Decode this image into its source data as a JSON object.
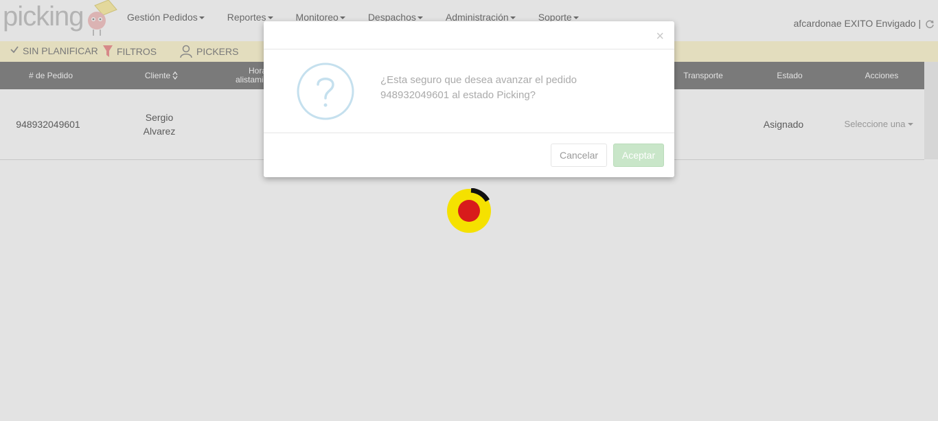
{
  "app": {
    "logo_text": "picking",
    "nav": [
      {
        "label": "Gestión Pedidos"
      },
      {
        "label": "Reportes"
      },
      {
        "label": "Monitoreo"
      },
      {
        "label": "Despachos"
      },
      {
        "label": "Administración"
      },
      {
        "label": "Soporte"
      }
    ],
    "user": "afcardonae EXITO Envigado |"
  },
  "toolbar": {
    "sin_planificar": "SIN PLANIFICAR",
    "filtros": "FILTROS",
    "pickers": "PICKERS"
  },
  "table": {
    "headers": {
      "pedido": "# de Pedido",
      "cliente": "Cliente",
      "hora": "Hora alistamiento",
      "transporte": "Transporte",
      "estado": "Estado",
      "acciones": "Acciones"
    },
    "rows": [
      {
        "pedido": "948932049601",
        "cliente": "Sergio Alvarez",
        "estado": "Asignado",
        "accion": "Seleccione una"
      }
    ]
  },
  "modal": {
    "close": "×",
    "message": "¿Esta seguro que desea avanzar el pedido 948932049601 al estado Picking?",
    "cancel": "Cancelar",
    "accept": "Aceptar"
  },
  "colors": {
    "toolbar_bg": "#fff9d6",
    "header_bg": "#8a8a8a",
    "accept_bg": "#c9e6c9",
    "loader_yellow": "#f5e100",
    "loader_red": "#d81b1b"
  }
}
